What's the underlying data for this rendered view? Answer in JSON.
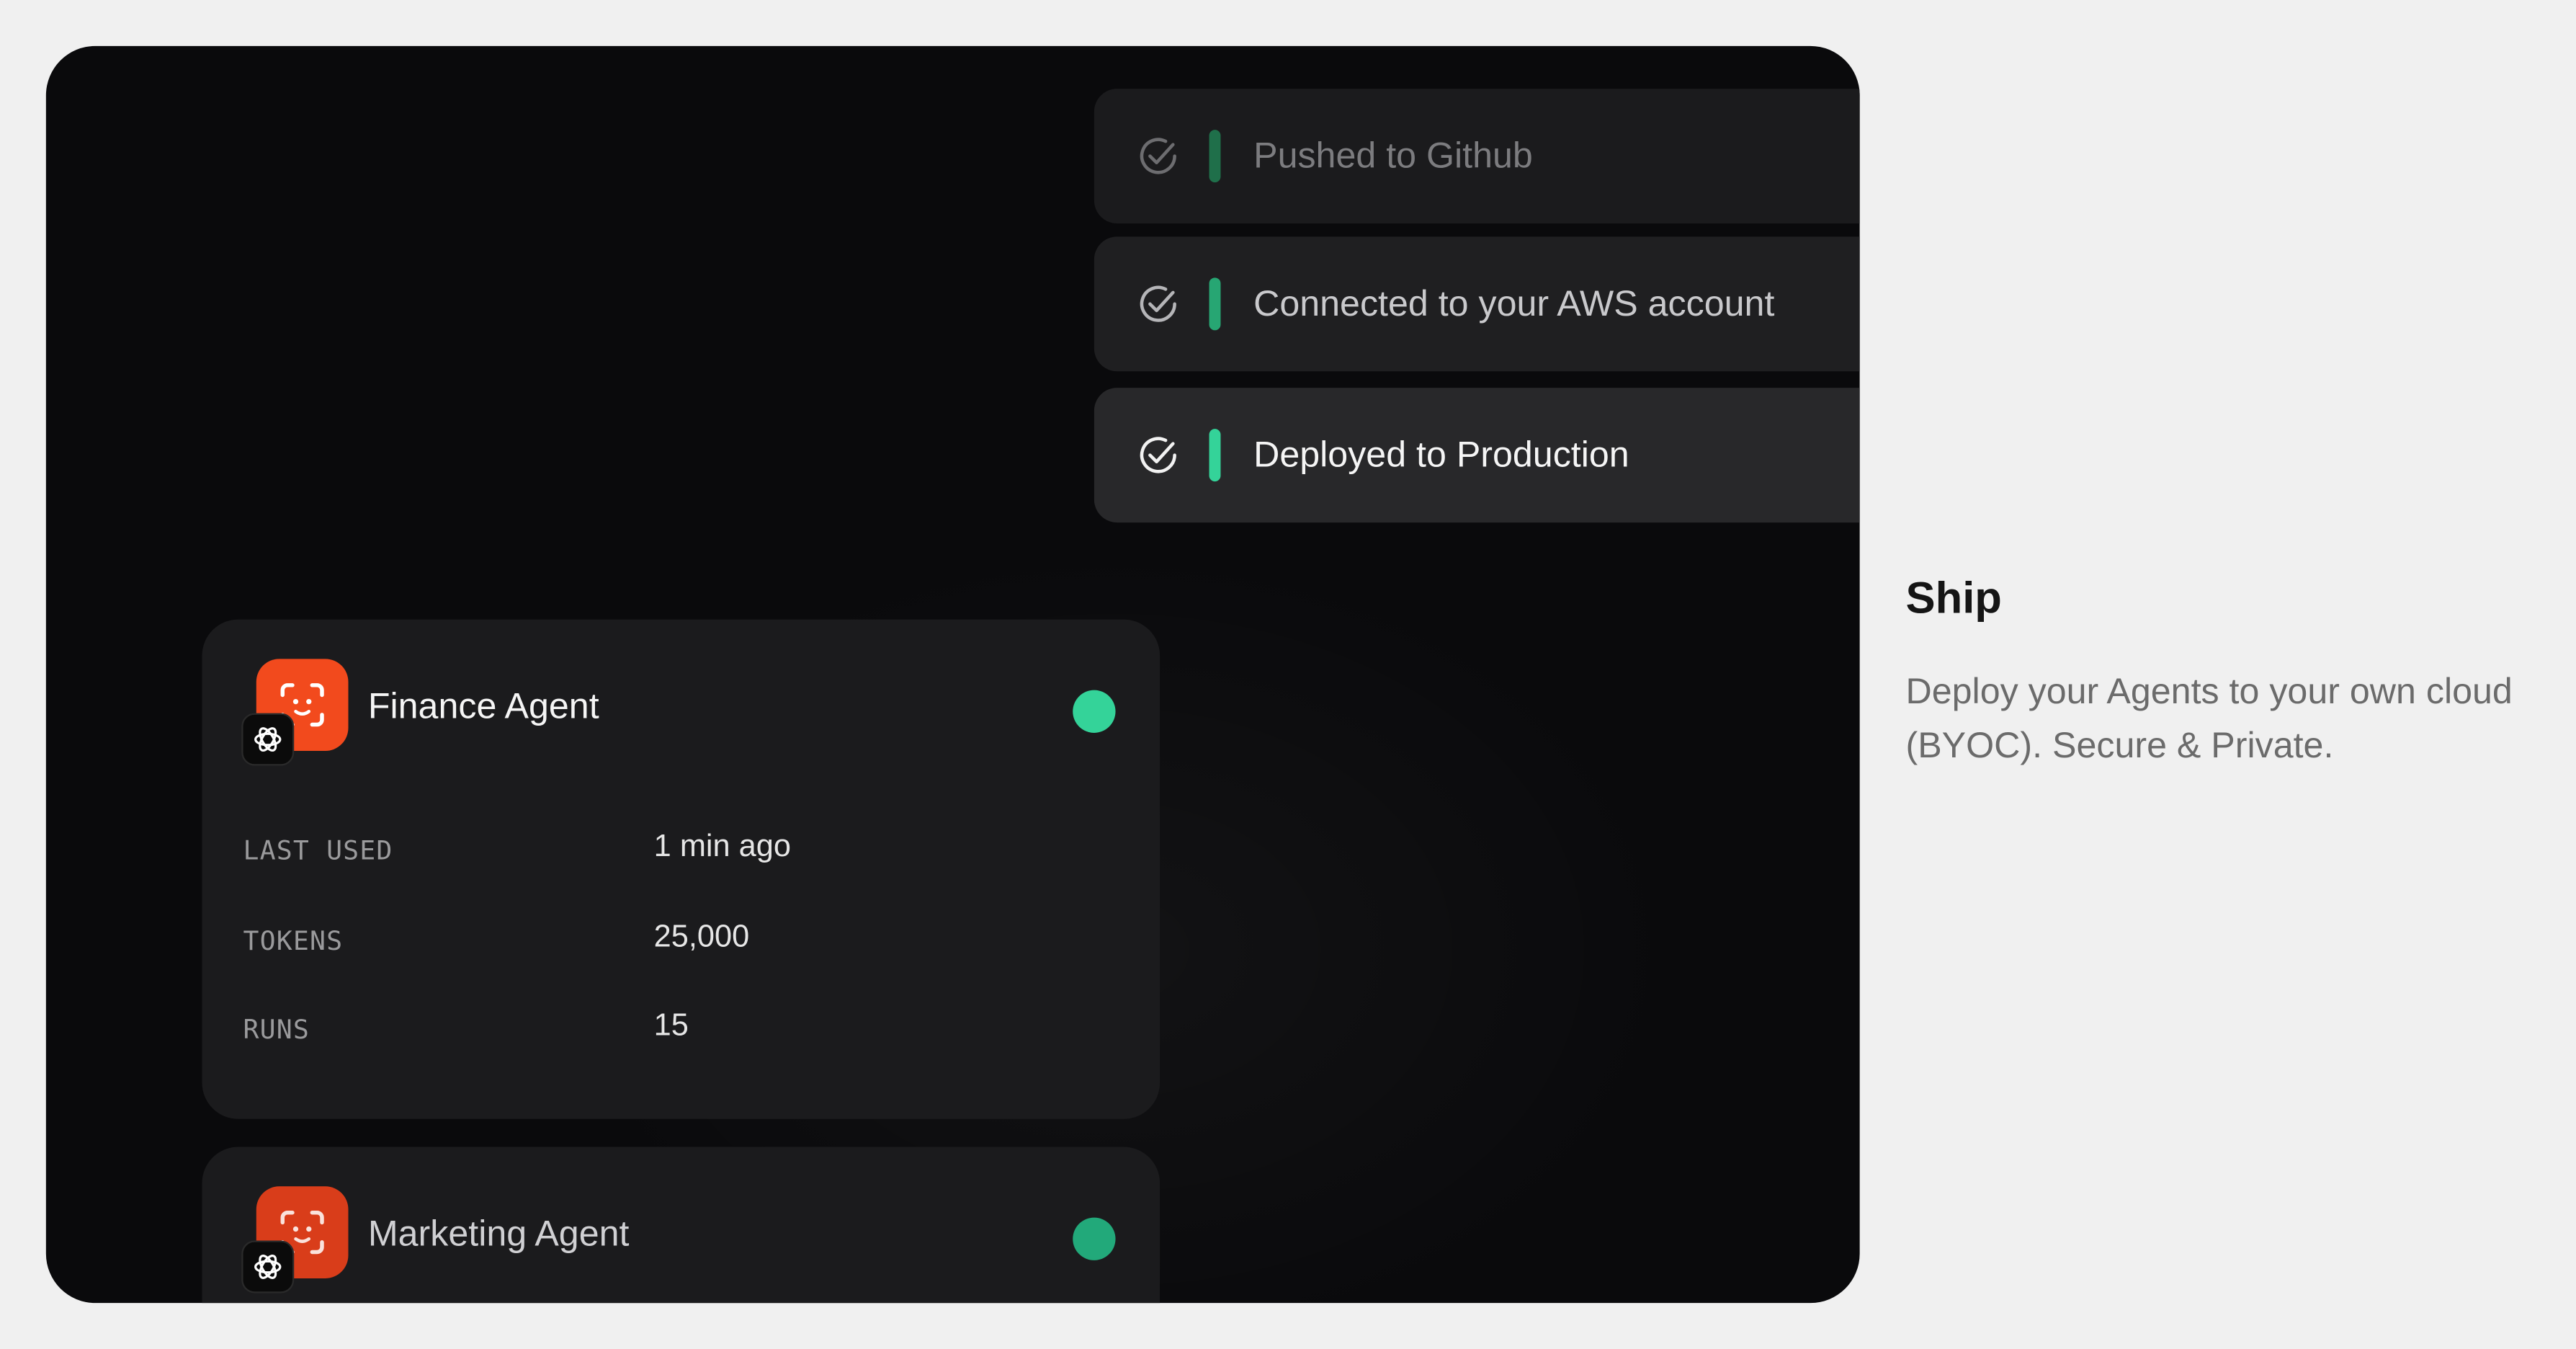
{
  "pipeline": {
    "steps": [
      {
        "label": "Pushed to Github"
      },
      {
        "label": "Connected to your AWS account"
      },
      {
        "label": "Deployed to Production"
      }
    ]
  },
  "agents": [
    {
      "name": "Finance Agent",
      "status_color": "#34d399",
      "stats": [
        {
          "key": "LAST USED",
          "value": "1 min ago"
        },
        {
          "key": "TOKENS",
          "value": "25,000"
        },
        {
          "key": "RUNS",
          "value": "15"
        }
      ]
    },
    {
      "name": "Marketing Agent",
      "status_color": "#22a97a"
    }
  ],
  "icons": {
    "agent_icon": "scan-face-icon",
    "badge_icon": "openai-logo-icon",
    "step_icon": "check-circle-icon"
  },
  "colors": {
    "accent_green": "#2ec48a",
    "agent_orange": "#f24a1d"
  },
  "side": {
    "title": "Ship",
    "description": "Deploy your Agents to your own cloud (BYOC). Secure & Private."
  }
}
